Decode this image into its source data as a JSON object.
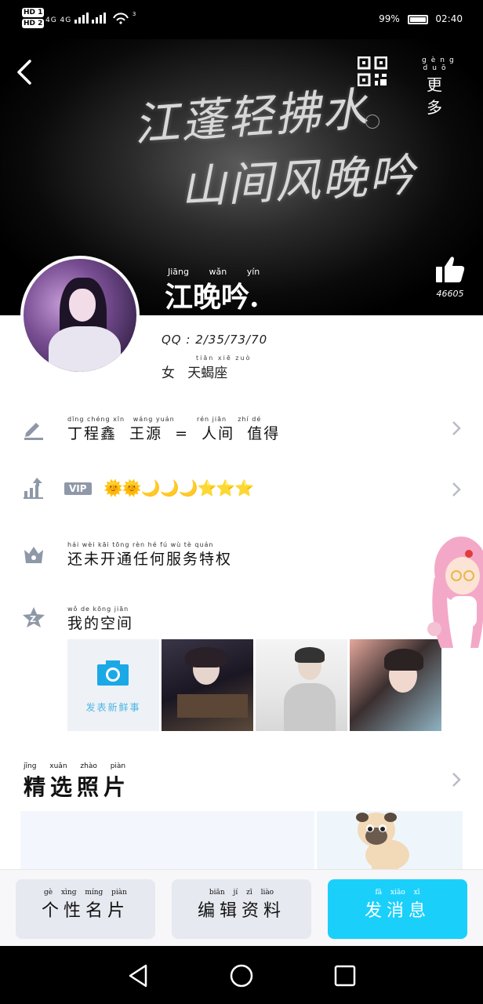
{
  "status_bar": {
    "hd1": "HD 1",
    "hd2": "HD 2",
    "signal": "4G 4G",
    "wifi_badge": "3",
    "battery": "99%",
    "time": "02:40"
  },
  "header": {
    "more_label": "更 多",
    "more_pinyin": "gèng duō",
    "banner_line1": "江蓬轻拂水",
    "banner_line2": "山间风晚吟",
    "nickname": "江晚吟.",
    "nickname_pinyin": "Jiāng wǎn yín",
    "likes": "46605"
  },
  "profile": {
    "qq": "QQ : 2/35/73/70",
    "meta": "女   天蝎座",
    "meta_pinyin": "tiān xiē zuò",
    "signature": "丁程鑫  王源  =  人间  值得",
    "signature_pinyin": "dīng chéng xīn   wáng yuán        rén jiān    zhí dé",
    "vip_label": "VIP",
    "vip_badges": "🌞🌞🌙🌙🌙⭐⭐⭐",
    "service_text": "还未开通任何服务特权",
    "service_pinyin": "hái wèi kāi tōng rèn hé fú wù tè quán",
    "space_text": "我的空间",
    "space_pinyin": "wǒ de kōng jiān",
    "upload_label": "发表新鲜事"
  },
  "selected": {
    "title": "精选照片",
    "pinyin": "jīng xuǎn zhào piàn"
  },
  "bottom_bar": {
    "card_label": "个性名片",
    "card_pinyin": "gè xìng míng piàn",
    "edit_label": "编辑资料",
    "edit_pinyin": "biān jí zī liào",
    "message_label": "发消息",
    "message_pinyin": "fā xiāo xī"
  },
  "colors": {
    "accent": "#1ad0fb",
    "icon_gray": "#8f98a8"
  },
  "icons": [
    "back-icon",
    "qr-code-icon",
    "thumbs-up-icon",
    "pencil-icon",
    "level-up-icon",
    "crown-icon",
    "space-star-icon",
    "camera-icon",
    "chevron-right-icon",
    "nav-back-icon",
    "nav-home-icon",
    "nav-recent-icon"
  ]
}
